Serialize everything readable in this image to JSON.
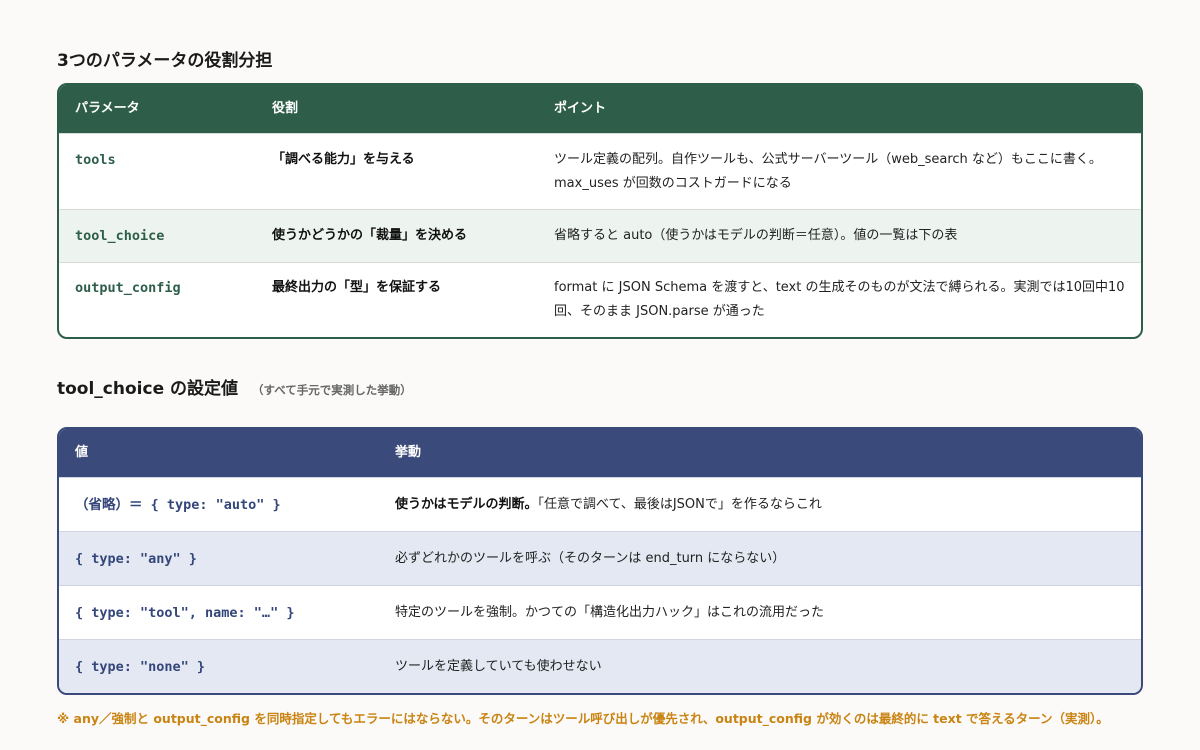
{
  "section1": {
    "title": "3つのパラメータの役割分担",
    "headers": [
      "パラメータ",
      "役割",
      "ポイント"
    ],
    "rows": [
      {
        "param": "tools",
        "role": "「調べる能力」を与える",
        "point": "ツール定義の配列。自作ツールも、公式サーバーツール（web_search など）もここに書く。max_uses が回数のコストガードになる"
      },
      {
        "param": "tool_choice",
        "role": "使うかどうかの「裁量」を決める",
        "point": "省略すると auto（使うかはモデルの判断＝任意）。値の一覧は下の表"
      },
      {
        "param": "output_config",
        "role": "最終出力の「型」を保証する",
        "point": "format に JSON Schema を渡すと、text の生成そのものが文法で縛られる。実測では10回中10回、そのまま JSON.parse が通った"
      }
    ]
  },
  "section2": {
    "title": "tool_choice の設定値",
    "subtitle": "（すべて手元で実測した挙動）",
    "headers": [
      "値",
      "挙動"
    ],
    "rows": [
      {
        "value": "（省略）＝ { type: \"auto\" }",
        "behavior_bold": "使うかはモデルの判断。",
        "behavior": "「任意で調べて、最後はJSONで」を作るならこれ"
      },
      {
        "value": "{ type: \"any\" }",
        "behavior_bold": "",
        "behavior": "必ずどれかのツールを呼ぶ（そのターンは end_turn にならない）"
      },
      {
        "value": "{ type: \"tool\", name: \"…\" }",
        "behavior_bold": "",
        "behavior": "特定のツールを強制。かつての「構造化出力ハック」はこれの流用だった"
      },
      {
        "value": "{ type: \"none\" }",
        "behavior_bold": "",
        "behavior": "ツールを定義していても使わせない"
      }
    ]
  },
  "note": "※ any／強制と output_config を同時指定してもエラーにはならない。そのターンはツール呼び出しが優先され、output_config が効くのは最終的に text で答えるターン（実測）。",
  "colors": {
    "green_header": "#2e5e4a",
    "navy_header": "#3a4a7a",
    "note_orange": "#c98413"
  }
}
